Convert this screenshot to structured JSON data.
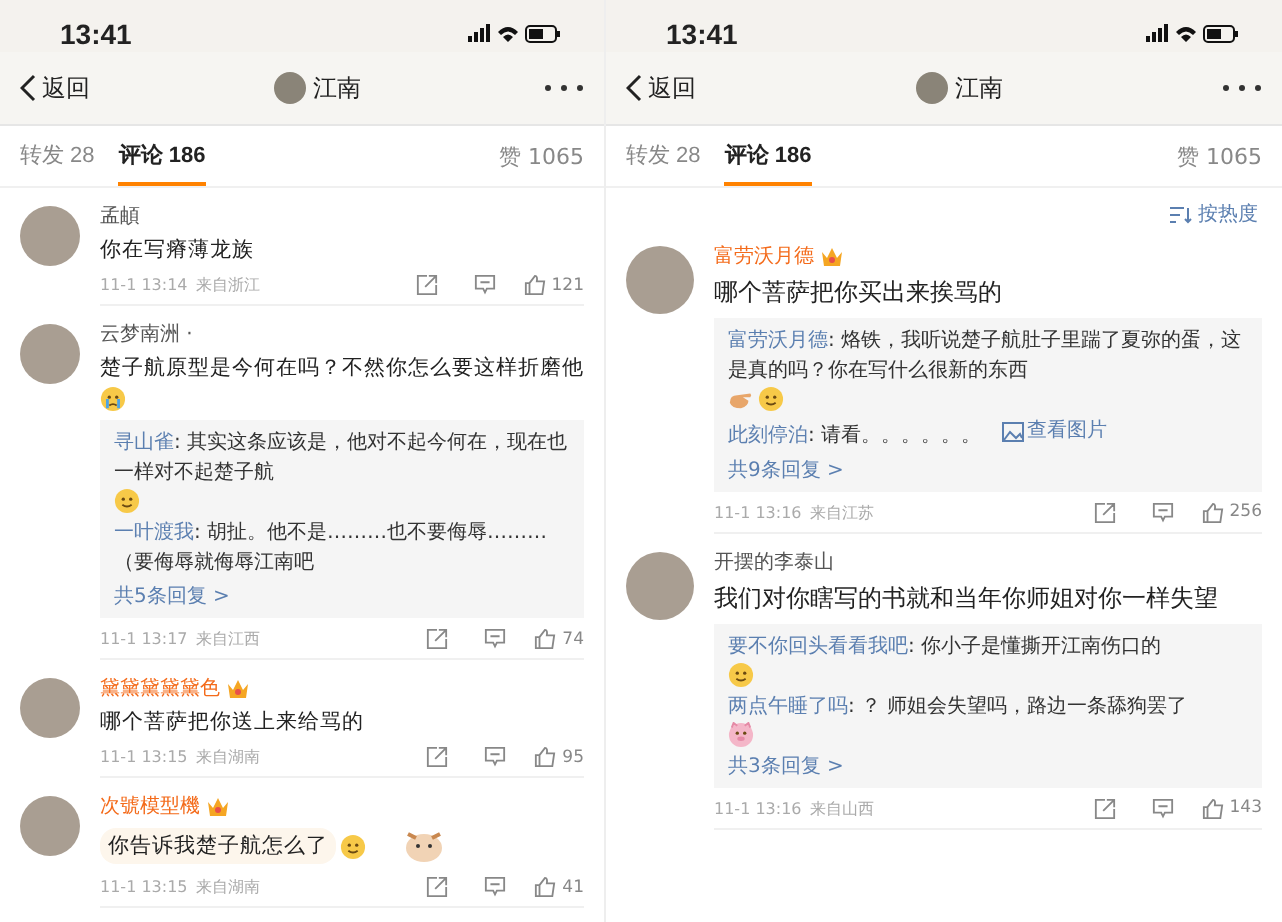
{
  "phones": [
    {
      "status_time": "13:41",
      "header": {
        "back": "返回",
        "title": "江南"
      },
      "tabs": [
        {
          "label": "转发",
          "count": "28",
          "selected": false
        },
        {
          "label": "评论",
          "count": "186",
          "selected": true
        }
      ],
      "likes": "赞 1065",
      "comments": [
        {
          "user": "孟頔",
          "vip": false,
          "text": "你在写瘠薄龙族",
          "time": "11-1 13:14",
          "location": "来自浙江",
          "like_count": "121"
        },
        {
          "user": "云梦南洲 ·",
          "vip": false,
          "text": "楚子航原型是今何在吗？不然你怎么要这样折磨他",
          "emojis": [
            {
              "kind": "crying"
            }
          ],
          "replies": [
            {
              "user": "寻山雀",
              "text": ": 其实这条应该是，他对不起今何在，现在也一样对不起楚子航",
              "emojis": [
                {
                  "kind": "face"
                }
              ]
            },
            {
              "user": "一叶渡我",
              "text": ": 胡扯。他不是………也不要侮辱………（要侮辱就侮辱江南吧"
            }
          ],
          "more": "共5条回复 >",
          "time": "11-1 13:17",
          "location": "来自江西",
          "like_count": "74"
        },
        {
          "user": "黛黛黛黛黛色",
          "vip": true,
          "text": "哪个菩萨把你送上来给骂的",
          "time": "11-1 13:15",
          "location": "来自湖南",
          "like_count": "95"
        },
        {
          "user": "次號模型機",
          "vip": true,
          "text": "你告诉我楚子航怎么了",
          "emojis": [
            {
              "kind": "face"
            }
          ],
          "sticker": true,
          "time": "11-1 13:15",
          "location": "来自湖南",
          "like_count": "41"
        }
      ]
    },
    {
      "status_time": "13:41",
      "header": {
        "back": "返回",
        "title": "江南"
      },
      "tabs": [
        {
          "label": "转发",
          "count": "28",
          "selected": false
        },
        {
          "label": "评论",
          "count": "186",
          "selected": true
        }
      ],
      "likes": "赞 1065",
      "sort": "按热度",
      "comments": [
        {
          "user": "富劳沃月德",
          "vip": true,
          "text": "哪个菩萨把你买出来挨骂的",
          "replies": [
            {
              "user": "富劳沃月德",
              "text": ": 烙铁，我听说楚子航肚子里踹了夏弥的蛋，这是真的吗？你在写什么很新的东西",
              "emojis": [
                {
                  "kind": "hand"
                },
                {
                  "kind": "face"
                }
              ]
            },
            {
              "user": "此刻停泊",
              "text": ": 请看。。。。。。",
              "link": "查看图片"
            }
          ],
          "more": "共9条回复 >",
          "time": "11-1 13:16",
          "location": "来自江苏",
          "like_count": "256"
        },
        {
          "user": "开摆的李泰山",
          "vip": false,
          "text": "我们对你瞎写的书就和当年你师姐对你一样失望",
          "replies": [
            {
              "user": "要不你回头看看我吧",
              "text": ": 你小子是懂撕开江南伤口的",
              "emojis": [
                {
                  "kind": "face"
                }
              ]
            },
            {
              "user": "两点午睡了吗",
              "text": ": ？ 师姐会失望吗，路边一条舔狗罢了",
              "emojis": [
                {
                  "kind": "pig"
                }
              ]
            }
          ],
          "more": "共3条回复 >",
          "time": "11-1 13:16",
          "location": "来自山西",
          "like_count": "143"
        }
      ]
    }
  ]
}
